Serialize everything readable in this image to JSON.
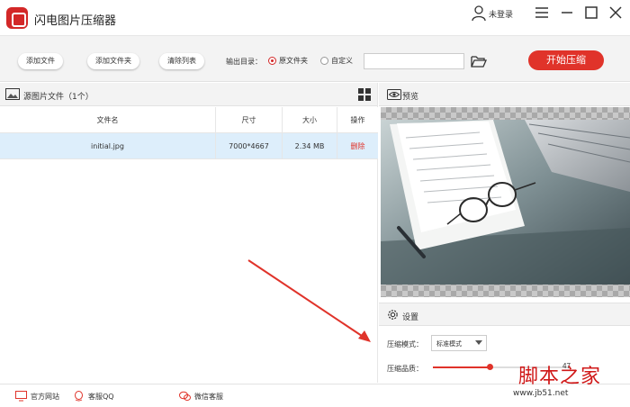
{
  "app": {
    "title": "闪电图片压缩器",
    "user_label": "未登录"
  },
  "toolbar": {
    "add_file": "添加文件",
    "add_folder": "添加文件夹",
    "clear_list": "清除列表",
    "output_label": "输出目录：",
    "output_options": [
      {
        "label": "原文件夹",
        "checked": true
      },
      {
        "label": "自定义",
        "checked": false
      }
    ],
    "custom_path_value": "",
    "start_button": "开始压缩"
  },
  "file_panel": {
    "title": "源图片文件（1个）",
    "columns": [
      "文件名",
      "尺寸",
      "大小",
      "操作"
    ],
    "rows": [
      {
        "name": "initial.jpg",
        "dimensions": "7000*4667",
        "size": "2.34 MB",
        "action": "删除",
        "selected": true
      }
    ]
  },
  "preview": {
    "title": "预览"
  },
  "settings": {
    "title": "设置",
    "mode_label": "压缩模式：",
    "mode_value": "标准模式",
    "quality_label": "压缩品质：",
    "quality_value": "47",
    "quality_fraction": 0.42
  },
  "footer": {
    "links": [
      "官方网站",
      "客服QQ",
      "微信客服"
    ]
  },
  "watermark": {
    "text": "脚本之家",
    "url": "www.jb51.net"
  },
  "colors": {
    "accent": "#e0332a",
    "selected_row": "#ddeefb",
    "toolbar_bg": "#f3f3f3"
  }
}
